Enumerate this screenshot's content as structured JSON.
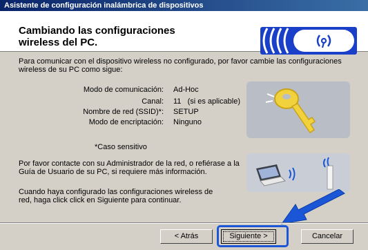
{
  "window": {
    "title": "Asistente de configuración inalámbrica de dispositivos"
  },
  "header": {
    "title": "Cambiando las configuraciones wireless del PC."
  },
  "intro": "Para  comunicar con el dispositivo wireless no configurado, por favor cambie las configuraciones wireless de su PC como sigue:",
  "settings": [
    {
      "label": "Modo de comunicación:",
      "value": "Ad-Hoc"
    },
    {
      "label": "Canal:",
      "value": "11   (si es aplicable)"
    },
    {
      "label": "Nombre de red (SSID)*:",
      "value": "SETUP"
    },
    {
      "label": "Modo de encriptación:",
      "value": "Ninguno"
    }
  ],
  "case_note": "*Caso sensitivo",
  "contact_text": "Por favor contacte con su Administrador de la red, o refiérase a la Guía de Usuario de su PC, si requiere más información.",
  "continue_text": "Cuando haya configurado las configuraciones wireless de red, haga click click en Siguiente para continuar.",
  "buttons": {
    "back": "< Atrás",
    "next": "Siguiente >",
    "cancel": "Cancelar"
  },
  "icons": {
    "logo": "wireless-logo-icon",
    "key": "key-icon",
    "laptop": "laptop-icon",
    "access_point": "access-point-icon",
    "arrow": "pointer-arrow-icon"
  },
  "colors": {
    "titlebar": "#0a246a",
    "accent": "#1a56d6",
    "key": "#f2d23c"
  }
}
